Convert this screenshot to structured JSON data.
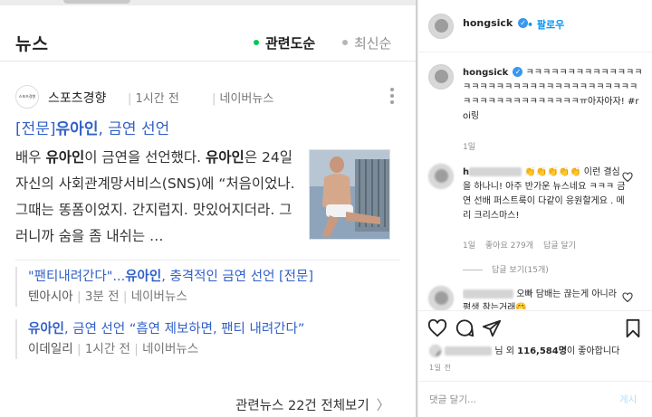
{
  "news": {
    "section_title": "뉴스",
    "sort_related": "관련도순",
    "sort_latest": "최신순",
    "press": {
      "logo_text": "스포츠경향",
      "name": "스포츠경향",
      "time": "1시간 전",
      "portal": "네이버뉴스"
    },
    "article": {
      "title_prefix": "[전문]",
      "title_name": "유아인",
      "title_suffix": ", 금연 선언",
      "body_parts": [
        {
          "text": "배우 ",
          "bold": false
        },
        {
          "text": "유아인",
          "bold": true
        },
        {
          "text": "이 금연을 선언했다. ",
          "bold": false
        },
        {
          "text": "유아인",
          "bold": true
        },
        {
          "text": "은 24일 자신의 사회관계망서비스(SNS)에 “처음이었나. 그때는 똥폼이었지. 간지럽지. 맛있어지더라. 그러니까 숨을 좀 내쉬는 …",
          "bold": false
        }
      ]
    },
    "related": [
      {
        "title_a": "\"팬티내려간다\"...",
        "title_name": "유아인",
        "title_b": ", 충격적인 금연 선언 [전문]",
        "press": "텐아시아",
        "time": "3분 전",
        "portal": "네이버뉴스"
      },
      {
        "title_a": "",
        "title_name": "유아인",
        "title_b": ", 금연 선언 “흡연 제보하면, 팬티 내려간다”",
        "press": "이데일리",
        "time": "1시간 전",
        "portal": "네이버뉴스"
      }
    ],
    "all_news": "관련뉴스 22건 전체보기",
    "all_news_chevron": "〉"
  },
  "instagram": {
    "username": "hongsick",
    "verified_mark": "✓",
    "follow_label": "팔로우",
    "caption_user": "hongsick",
    "caption_text": "ㅋㅋㅋㅋㅋㅋㅋㅋㅋㅋㅋㅋㅋㅋㅋㅋㅋㅋㅋㅋㅋㅋㅋㅋㅋㅋㅋㅋㅋㅋㅋㅋㅋㅋㅋㅋㅋㅋㅋㅋㅋㅋㅋㅋㅋㅋㅋㅋㅋㅠ아자아자! #roi링",
    "caption_time": "1일",
    "comment1_user_visible": "h",
    "comment1_emojis": "👏👏👏👏👏",
    "comment1_text": "이런 결심을 하나니! 아주 반가운 뉴스네요 ㅋㅋㅋ 금연 선배 퍼스트룩이 다같이 응원할게요 . 메리 크리스마스!",
    "comment1_time": "1일",
    "comment1_likes": "좋아요 279개",
    "comment1_reply": "답글 달기",
    "view_replies": "답글 보기(15개)",
    "comment2_text": "오빠 담배는 끊는게 아니라 평생 참는거래🤭",
    "likes_suffix": "님 외",
    "likes_count": "116,584명",
    "likes_tail": "이 좋아합니다",
    "post_time": "1일 전",
    "comment_placeholder": "댓글 달기...",
    "post_button": "게시"
  },
  "colors": {
    "naver_green": "#03c75a",
    "link_blue": "#3160c8",
    "ig_blue": "#0095f6"
  }
}
